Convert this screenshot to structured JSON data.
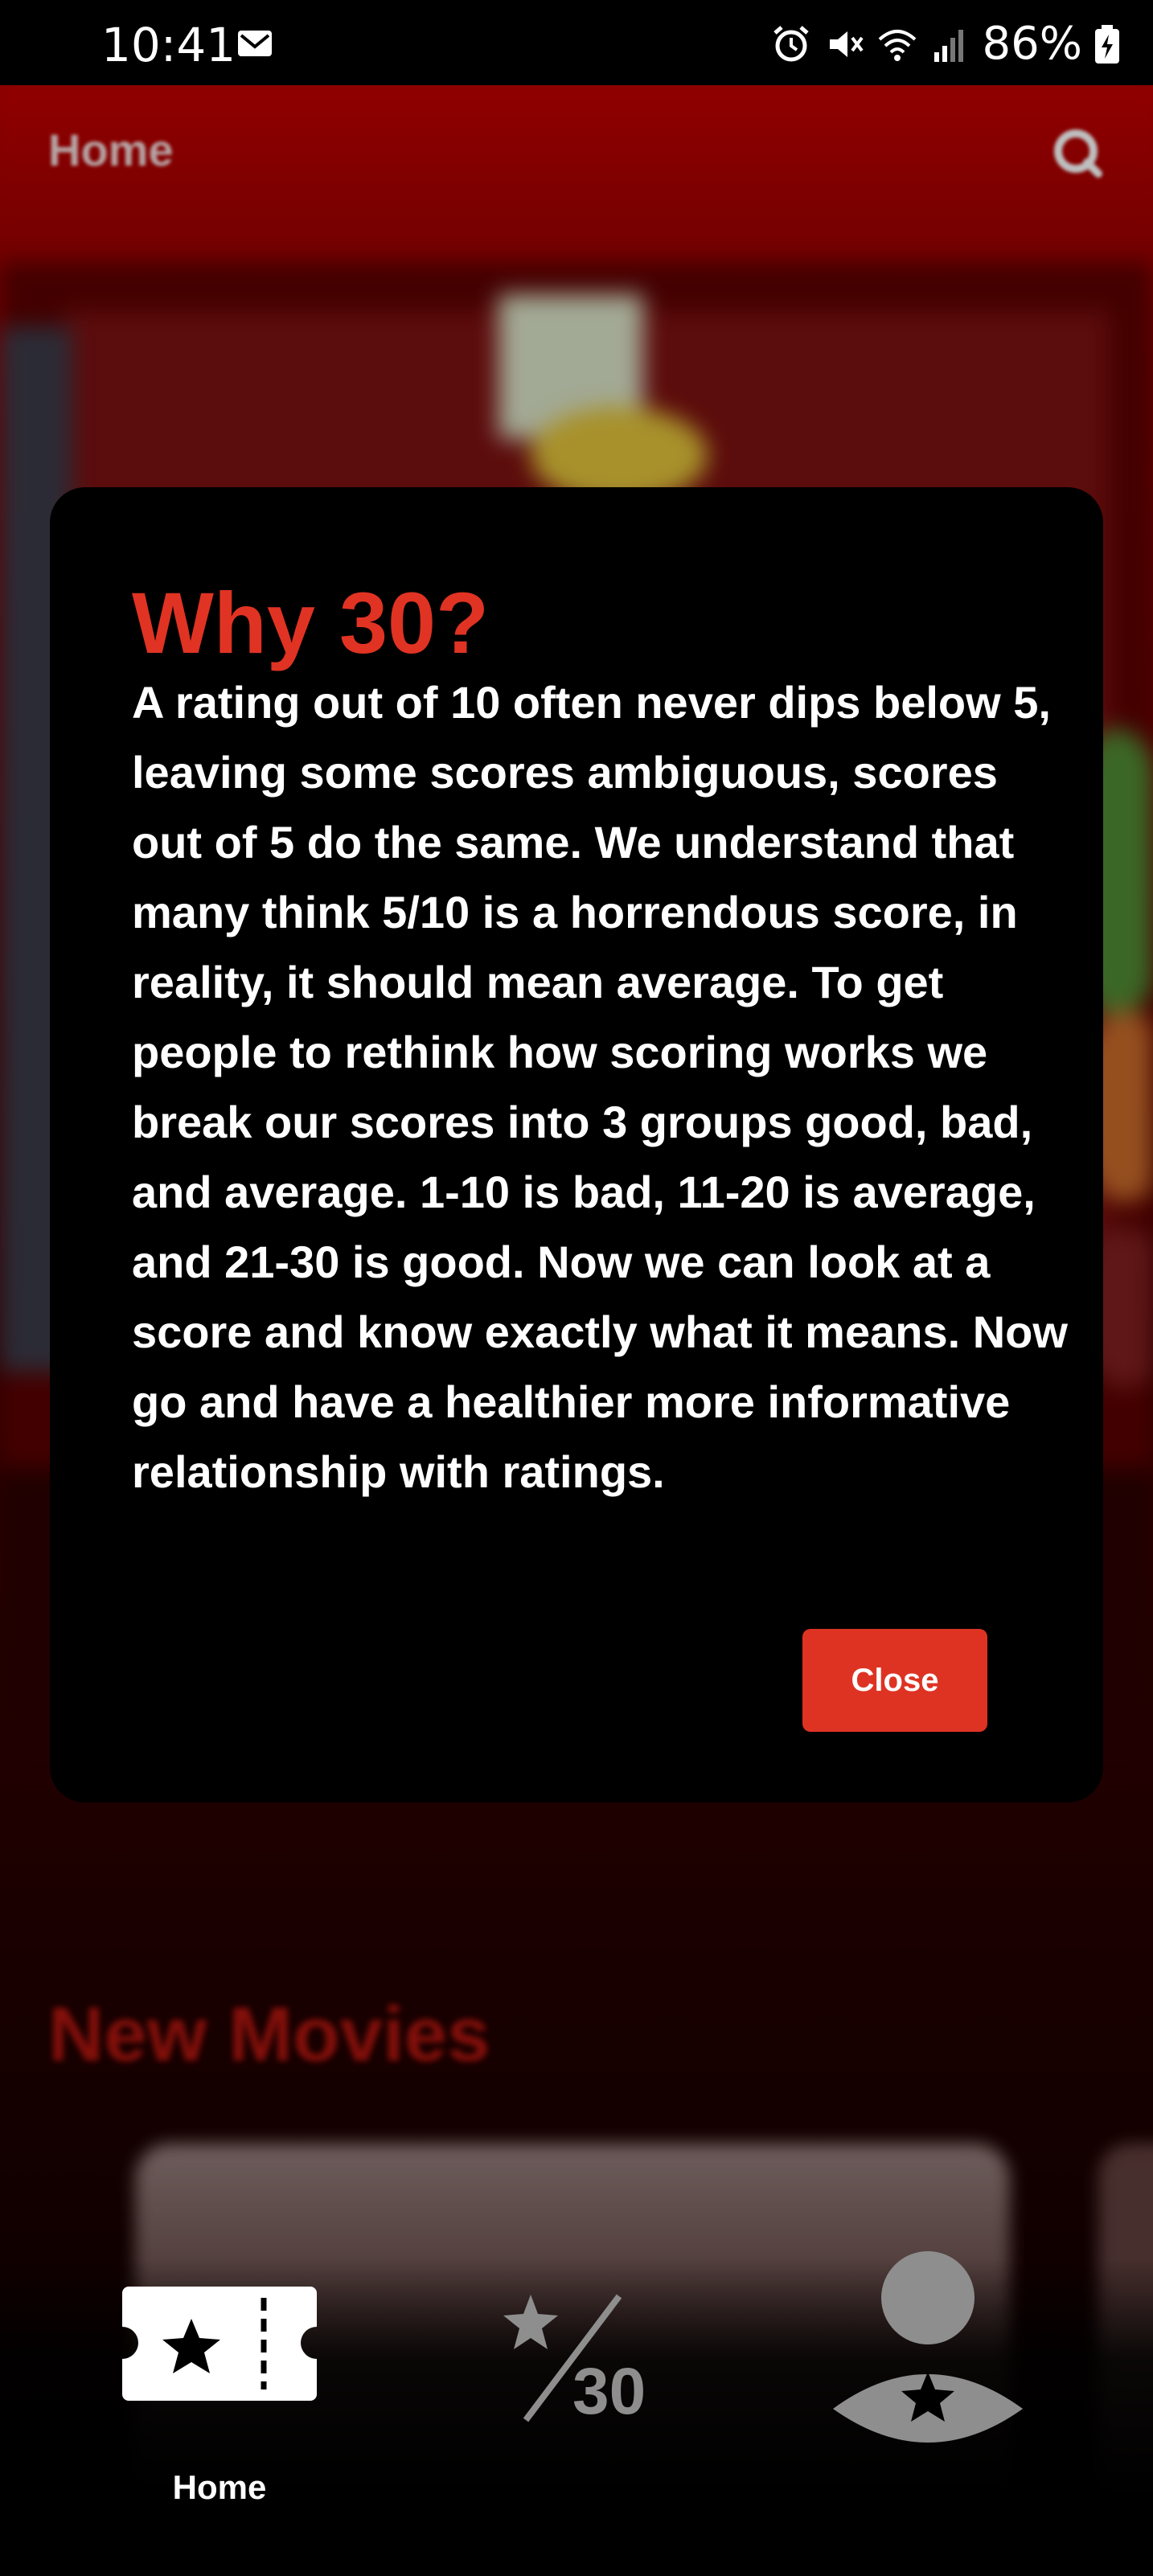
{
  "status_bar": {
    "time": "10:41",
    "battery": "86%",
    "icons": [
      "mail-icon",
      "alarm-icon",
      "mute-icon",
      "wifi-icon",
      "signal-icon",
      "battery-charging-icon"
    ]
  },
  "header": {
    "title": "Home",
    "search_icon": "search-icon"
  },
  "modal": {
    "title": "Why 30?",
    "body": "A rating out of 10 often never dips below 5, leaving some scores ambiguous, scores out of 5 do the same. We understand that many think 5/10 is a horrendous score, in reality, it should mean average. To get people to rethink how scoring works we break our scores into 3 groups good, bad, and average. 1-10 is bad, 11-20 is average, and 21-30 is good. Now we can look at a score and know exactly what it means. Now go and have a healthier more informative relationship with ratings.",
    "close_label": "Close"
  },
  "sections": {
    "new_movies_title": "New Movies"
  },
  "bottom_nav": {
    "home_label": "Home",
    "ratings_icon_text": "30",
    "active": "home"
  },
  "colors": {
    "accent": "#de3323",
    "header_red": "#b70000",
    "modal_bg": "#000000"
  }
}
